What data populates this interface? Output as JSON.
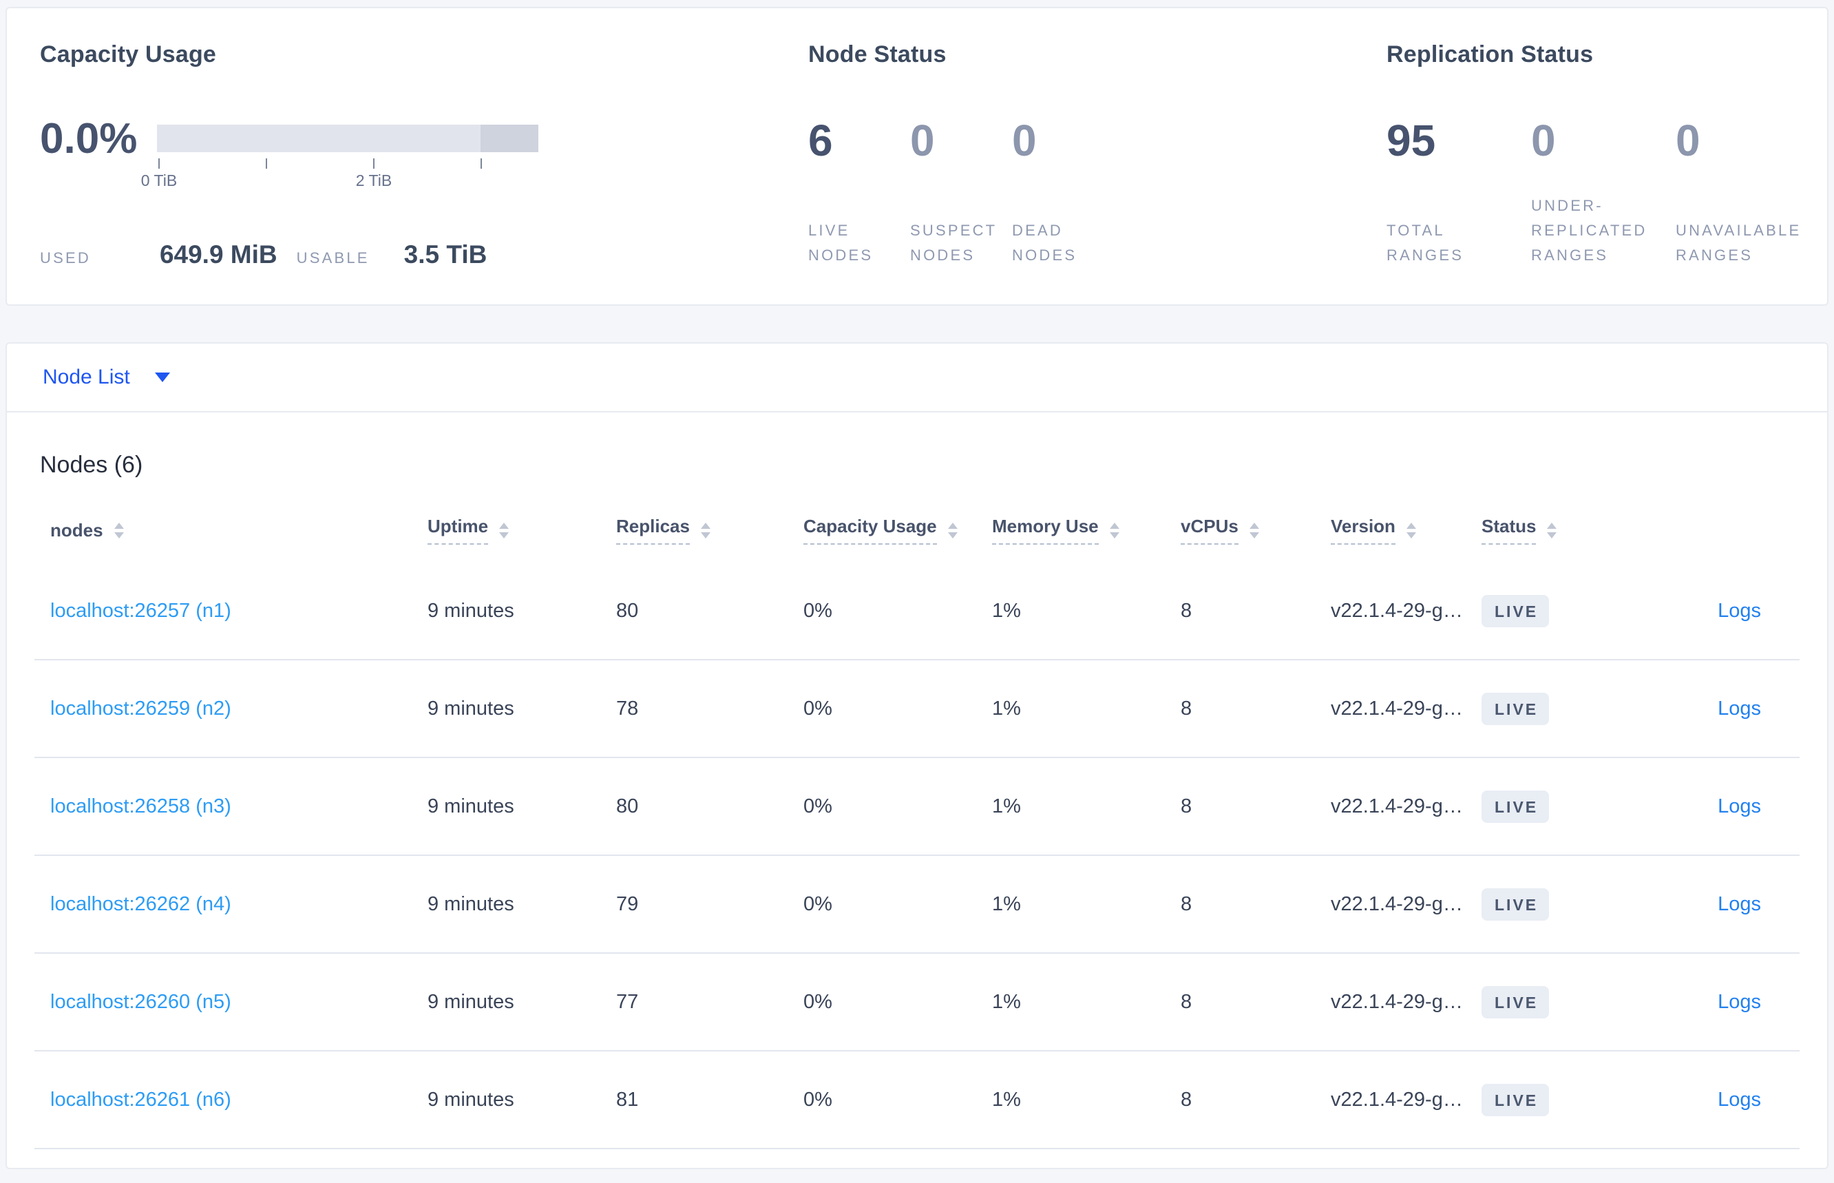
{
  "colors": {
    "page_background": "#f4f6f9",
    "accent_blue": "#1f56f0",
    "node_link_blue": "#2d9cf4",
    "logs_link_blue": "#2281ef",
    "stat_dark": "#47536e",
    "stat_dim": "#8c96ad",
    "badge_background": "#e9edf4",
    "bar_track": "#e2e4ed",
    "bar_reserved": "#cfd3de"
  },
  "summary": {
    "capacity": {
      "title": "Capacity Usage",
      "percent": "0.0%",
      "ticks": {
        "t0": "0 TiB",
        "t2": "2 TiB"
      },
      "used_label": "USED",
      "used_value": "649.9 MiB",
      "usable_label": "USABLE",
      "usable_value": "3.5 TiB"
    },
    "node_status": {
      "title": "Node Status",
      "stats": [
        {
          "value": "6",
          "label": "LIVE NODES"
        },
        {
          "value": "0",
          "label": "SUSPECT NODES"
        },
        {
          "value": "0",
          "label": "DEAD NODES"
        }
      ]
    },
    "replication": {
      "title": "Replication Status",
      "stats": [
        {
          "value": "95",
          "label": "TOTAL RANGES"
        },
        {
          "value": "0",
          "label": "UNDER-REPLICATED RANGES"
        },
        {
          "value": "0",
          "label": "UNAVAILABLE RANGES"
        }
      ]
    }
  },
  "view_selector": {
    "label": "Node List"
  },
  "nodes_section": {
    "title": "Nodes (6)",
    "columns": [
      {
        "label": "nodes"
      },
      {
        "label": "Uptime"
      },
      {
        "label": "Replicas"
      },
      {
        "label": "Capacity Usage"
      },
      {
        "label": "Memory Use"
      },
      {
        "label": "vCPUs"
      },
      {
        "label": "Version"
      },
      {
        "label": "Status"
      }
    ],
    "rows": [
      {
        "node": "localhost:26257 (n1)",
        "uptime": "9 minutes",
        "replicas": "80",
        "capacity": "0%",
        "memory": "1%",
        "vcpus": "8",
        "version": "v22.1.4-29-g…",
        "status": "LIVE",
        "logs": "Logs"
      },
      {
        "node": "localhost:26259 (n2)",
        "uptime": "9 minutes",
        "replicas": "78",
        "capacity": "0%",
        "memory": "1%",
        "vcpus": "8",
        "version": "v22.1.4-29-g…",
        "status": "LIVE",
        "logs": "Logs"
      },
      {
        "node": "localhost:26258 (n3)",
        "uptime": "9 minutes",
        "replicas": "80",
        "capacity": "0%",
        "memory": "1%",
        "vcpus": "8",
        "version": "v22.1.4-29-g…",
        "status": "LIVE",
        "logs": "Logs"
      },
      {
        "node": "localhost:26262 (n4)",
        "uptime": "9 minutes",
        "replicas": "79",
        "capacity": "0%",
        "memory": "1%",
        "vcpus": "8",
        "version": "v22.1.4-29-g…",
        "status": "LIVE",
        "logs": "Logs"
      },
      {
        "node": "localhost:26260 (n5)",
        "uptime": "9 minutes",
        "replicas": "77",
        "capacity": "0%",
        "memory": "1%",
        "vcpus": "8",
        "version": "v22.1.4-29-g…",
        "status": "LIVE",
        "logs": "Logs"
      },
      {
        "node": "localhost:26261 (n6)",
        "uptime": "9 minutes",
        "replicas": "81",
        "capacity": "0%",
        "memory": "1%",
        "vcpus": "8",
        "version": "v22.1.4-29-g…",
        "status": "LIVE",
        "logs": "Logs"
      }
    ]
  }
}
